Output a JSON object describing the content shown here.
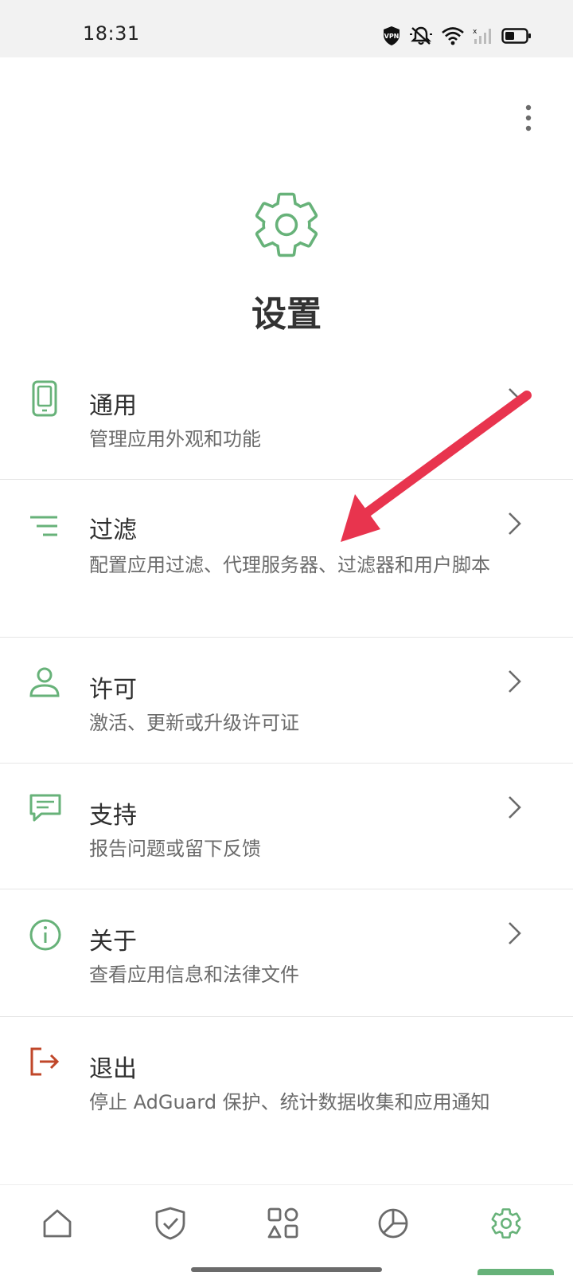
{
  "status_bar": {
    "time": "18:31",
    "icons": [
      "vpn-icon",
      "mute-icon",
      "wifi-icon",
      "signal-icon",
      "battery-icon"
    ]
  },
  "header": {
    "title": "设置",
    "menu_icon": "more-vertical-icon"
  },
  "colors": {
    "accent": "#67b279",
    "logout": "#c0472a",
    "annotation_arrow": "#e8344e",
    "text_primary": "#2f2f2f",
    "text_secondary": "#6b6b6b"
  },
  "settings": [
    {
      "title": "通用",
      "subtitle": "管理应用外观和功能",
      "icon": "phone-icon"
    },
    {
      "title": "过滤",
      "subtitle": "配置应用过滤、代理服务器、过滤器和用户脚本",
      "icon": "filter-lines-icon"
    },
    {
      "title": "许可",
      "subtitle": "激活、更新或升级许可证",
      "icon": "user-icon"
    },
    {
      "title": "支持",
      "subtitle": "报告问题或留下反馈",
      "icon": "chat-icon"
    },
    {
      "title": "关于",
      "subtitle": "查看应用信息和法律文件",
      "icon": "info-icon"
    },
    {
      "title": "退出",
      "subtitle": "停止 AdGuard 保护、统计数据收集和应用通知",
      "icon": "logout-icon"
    }
  ],
  "bottom_nav": {
    "items": [
      "home-icon",
      "shield-icon",
      "apps-icon",
      "stats-icon",
      "settings-icon"
    ],
    "active": "settings-icon"
  }
}
